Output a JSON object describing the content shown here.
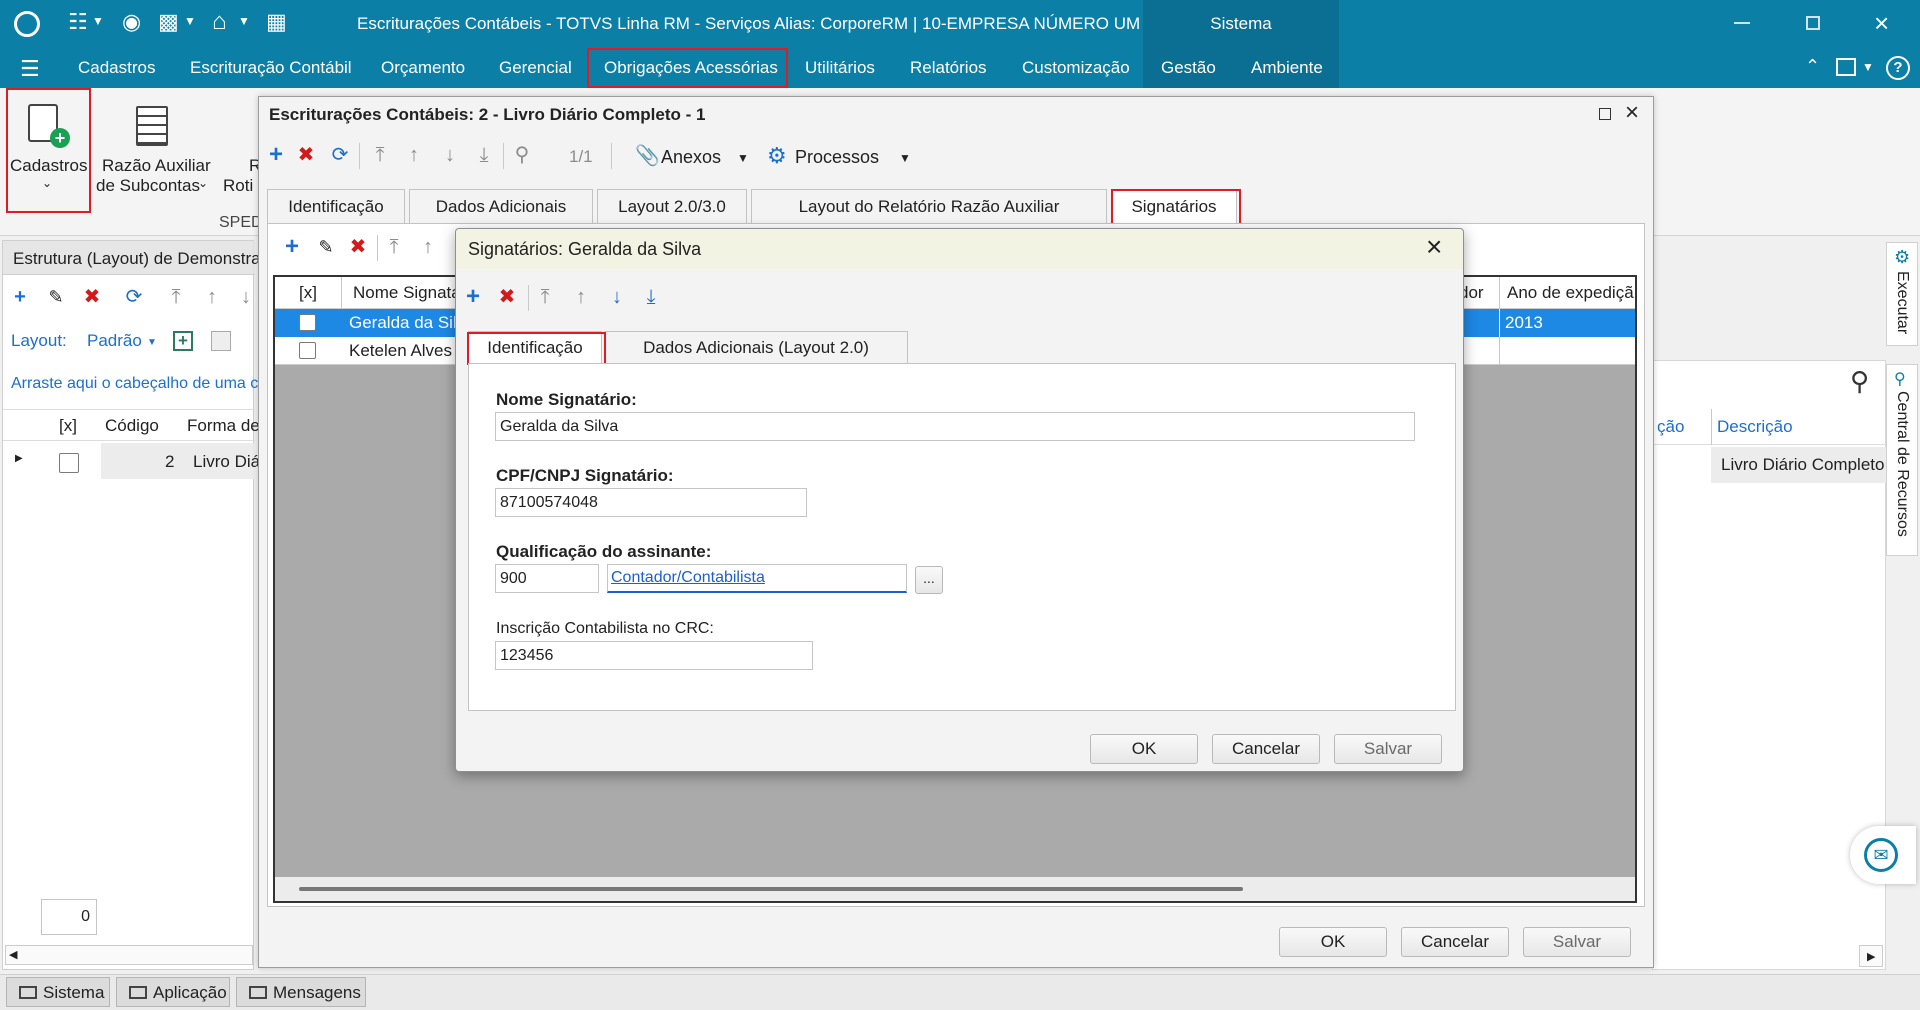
{
  "window": {
    "title": "Escriturações Contábeis - TOTVS Linha RM - Serviços  Alias: CorporeRM | 10-EMPRESA NÚMERO UM",
    "system_tab": "Sistema"
  },
  "menu": [
    "Cadastros",
    "Escrituração Contábil",
    "Orçamento",
    "Gerencial",
    "Obrigações Acessórias",
    "Utilitários",
    "Relatórios",
    "Customização",
    "Gestão",
    "Ambiente"
  ],
  "ribbon": {
    "cadastros": "Cadastros",
    "razao_line1": "Razão Auxiliar",
    "razao_line2": "de Subcontas",
    "partial_r": "R",
    "partial_roti": "Roti",
    "sped_group": "SPED"
  },
  "left_panel": {
    "header": "Estrutura (Layout) de Demonstraç",
    "layout_label": "Layout:",
    "layout_value": "Padrão",
    "drag_hint": "Arraste aqui o cabeçalho de uma c",
    "col_x": "[x]",
    "col_codigo": "Código",
    "col_forma": "Forma de",
    "row_codigo": "2",
    "row_forma": "Livro Diá",
    "counter": "0"
  },
  "right_grid": {
    "col_cao": "ção",
    "col_descricao": "Descrição",
    "row_descricao": "Livro Diário Completo"
  },
  "side_tabs": {
    "executar": "Executar",
    "central": "Central de Recursos"
  },
  "main_dialog": {
    "title": "Escriturações Contábeis: 2 - Livro Diário Completo - 1",
    "pager": "1/1",
    "anexos": "Anexos",
    "processos": "Processos",
    "tabs": [
      "Identificação",
      "Dados Adicionais",
      "Layout 2.0/3.0",
      "Layout do Relatório Razão Auxiliar",
      "Signatários"
    ],
    "grid_cols": {
      "x": "[x]",
      "nome": "Nome Signatá",
      "dor": "dor",
      "ano": "Ano de expediçã"
    },
    "rows": [
      {
        "nome": "Geralda da Silv",
        "ano": "2013"
      },
      {
        "nome": "Ketelen Alves",
        "ano": ""
      }
    ],
    "ok": "OK",
    "cancelar": "Cancelar",
    "salvar": "Salvar"
  },
  "sig_dialog": {
    "title": "Signatários: Geralda da Silva",
    "tabs": [
      "Identificação",
      "Dados Adicionais (Layout 2.0)"
    ],
    "nome_label": "Nome Signatário:",
    "nome_value": "Geralda da Silva",
    "cpf_label": "CPF/CNPJ Signatário:",
    "cpf_value": "87100574048",
    "qual_label": "Qualificação do assinante:",
    "qual_code": "900",
    "qual_desc": "Contador/Contabilista",
    "lookup": "...",
    "crc_label": "Inscrição Contabilista no CRC:",
    "crc_value": "123456",
    "ok": "OK",
    "cancelar": "Cancelar",
    "salvar": "Salvar"
  },
  "status_bar": [
    "Sistema",
    "Aplicação",
    "Mensagens"
  ],
  "colors": {
    "titlebar": "#0b7fa6",
    "highlight": "#e01b24",
    "selection": "#1e88e5"
  }
}
